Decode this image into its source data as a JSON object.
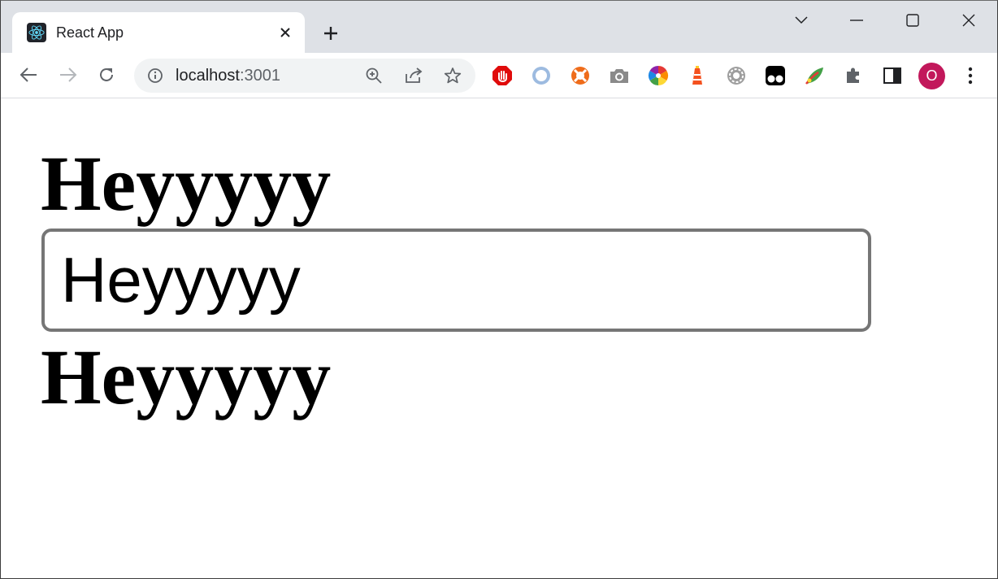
{
  "browser": {
    "tab": {
      "title": "React App"
    },
    "omnibox": {
      "host": "localhost",
      "port": ":3001"
    },
    "profile_initial": "O",
    "extensions": [
      "adblock-icon",
      "blue-swirl-icon",
      "orange-lifebuoy-icon",
      "camera-icon",
      "color-wheel-icon",
      "lighthouse-icon",
      "gear-extension-icon",
      "tampermonkey-icon",
      "leaf-icon"
    ]
  },
  "page": {
    "heading_top": "Heyyyyy",
    "input_value": "Heyyyyy",
    "heading_bottom": "Heyyyyy"
  },
  "colors": {
    "tabstrip_bg": "#dee1e6",
    "avatar_bg": "#c2185b",
    "input_border": "#767676"
  }
}
